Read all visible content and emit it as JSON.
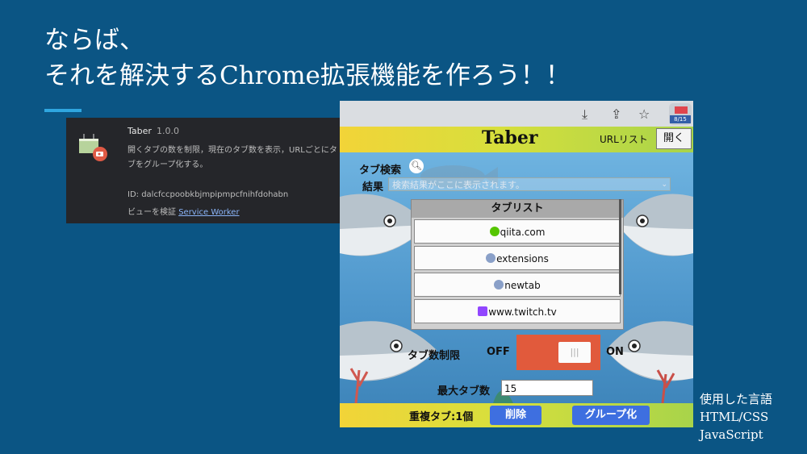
{
  "slide": {
    "title": "ならば、\nそれを解決するChrome拡張機能を作ろう！！",
    "languages": {
      "heading": "使用した言語",
      "items": [
        "HTML/CSS",
        "JavaScript"
      ]
    }
  },
  "extension_card": {
    "name": "Taber",
    "version": "1.0.0",
    "description": "開くタブの数を制限，現在のタブ数を表示，URLごとにタブをグループ化する。",
    "id_text": "ID: dalcfccpoobkbjmpipmpcfnihfdohabn",
    "inspect_prefix": "ビューを検証",
    "inspect_link": "Service Worker"
  },
  "browser_toolbar": {
    "badge_count": "8/15",
    "icons": [
      "download-icon",
      "share-icon",
      "star-icon"
    ]
  },
  "popup": {
    "app_title": "Taber",
    "url_list_label": "URLリスト",
    "open_button": "開く",
    "search_label": "タブ検索",
    "result_label": "結果",
    "result_placeholder": "検索結果がここに表示されます。",
    "tab_list": {
      "heading": "タブリスト",
      "items": [
        {
          "label": "qiita.com",
          "icon": "qiita-favicon",
          "color": "#55c500"
        },
        {
          "label": "extensions",
          "icon": "globe-icon",
          "color": "#8aa0c8"
        },
        {
          "label": "newtab",
          "icon": "globe-icon",
          "color": "#8aa0c8"
        },
        {
          "label": "www.twitch.tv",
          "icon": "twitch-favicon",
          "color": "#9146ff"
        }
      ]
    },
    "limit_label": "タブ数制限",
    "toggle": {
      "off": "OFF",
      "on": "ON",
      "knob": "|||",
      "state": "on"
    },
    "max_tabs_label": "最大タブ数",
    "max_tabs_value": "15",
    "duplicate_label": "重複タブ:1個",
    "delete_button": "削除",
    "group_button": "グループ化"
  },
  "colors": {
    "slide_bg": "#0b5584",
    "accent": "#2fa6e0",
    "header_yellow": "#f2d438",
    "header_green": "#a8d44a",
    "button_blue": "#3e6fe0",
    "toggle_red": "#e15a3c"
  }
}
